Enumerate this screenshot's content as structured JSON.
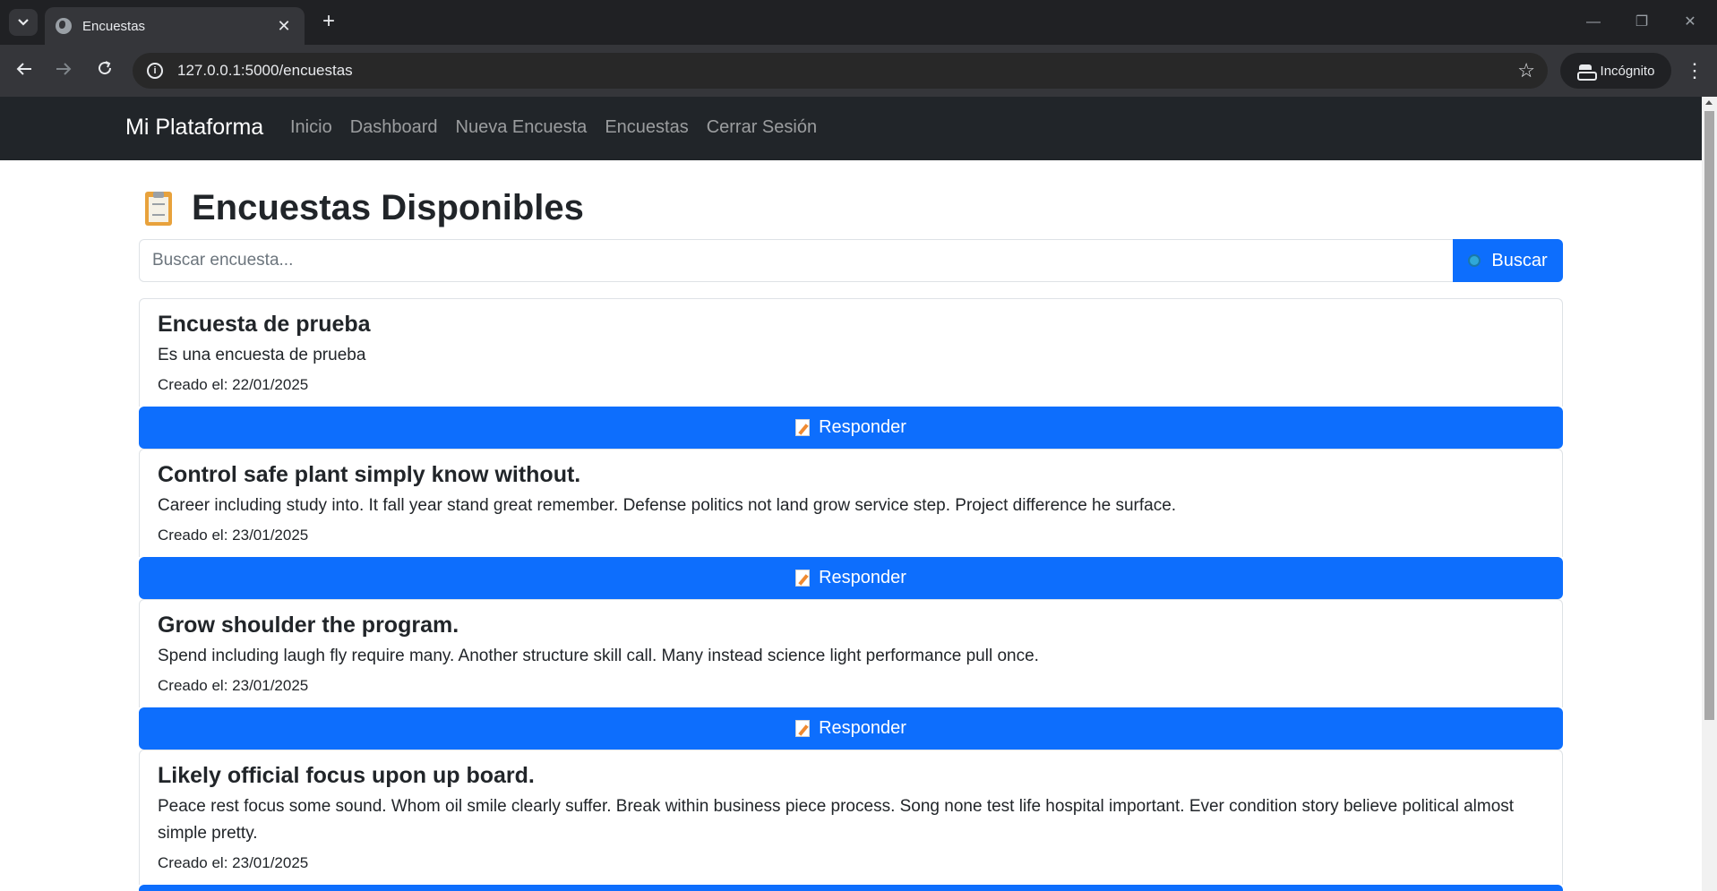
{
  "browser": {
    "tab_title": "Encuestas",
    "url": "127.0.0.1:5000/encuestas",
    "incognito_label": "Incógnito"
  },
  "navbar": {
    "brand": "Mi Plataforma",
    "links": [
      "Inicio",
      "Dashboard",
      "Nueva Encuesta",
      "Encuestas",
      "Cerrar Sesión"
    ]
  },
  "page": {
    "title": "Encuestas Disponibles",
    "search_placeholder": "Buscar encuesta...",
    "search_button": "Buscar",
    "respond_label": "Responder"
  },
  "surveys": [
    {
      "title": "Encuesta de prueba",
      "description": "Es una encuesta de prueba",
      "created": "Creado el: 22/01/2025"
    },
    {
      "title": "Control safe plant simply know without.",
      "description": "Career including study into. It fall year stand great remember. Defense politics not land grow service step. Project difference he surface.",
      "created": "Creado el: 23/01/2025"
    },
    {
      "title": "Grow shoulder the program.",
      "description": "Spend including laugh fly require many. Another structure skill call. Many instead science light performance pull once.",
      "created": "Creado el: 23/01/2025"
    },
    {
      "title": "Likely official focus upon up board.",
      "description": "Peace rest focus some sound. Whom oil smile clearly suffer. Break within business piece process. Song none test life hospital important. Ever condition story believe political almost simple pretty.",
      "created": "Creado el: 23/01/2025"
    }
  ]
}
